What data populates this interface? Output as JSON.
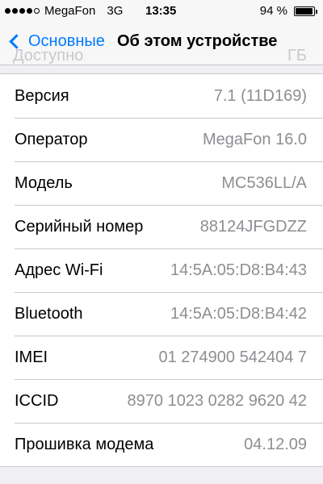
{
  "status_bar": {
    "carrier": "MegaFon",
    "network": "3G",
    "time": "13:35",
    "battery_percent": "94 %",
    "signal_dots_filled": 4,
    "signal_dots_total": 5
  },
  "navbar": {
    "back_label": "Основные",
    "title": "Об этом устройстве",
    "ghost_row_label": "Доступно",
    "ghost_row_value": "ГБ"
  },
  "rows": [
    {
      "label": "Версия",
      "value": "7.1 (11D169)"
    },
    {
      "label": "Оператор",
      "value": "MegaFon 16.0"
    },
    {
      "label": "Модель",
      "value": "MC536LL/A"
    },
    {
      "label": "Серийный номер",
      "value": "88124JFGDZZ"
    },
    {
      "label": "Адрес Wi-Fi",
      "value": "14:5A:05:D8:B4:43"
    },
    {
      "label": "Bluetooth",
      "value": "14:5A:05:D8:B4:42"
    },
    {
      "label": "IMEI",
      "value": "01 274900 542404 7"
    },
    {
      "label": "ICCID",
      "value": "8970 1023 0282 9620 42"
    },
    {
      "label": "Прошивка модема",
      "value": "04.12.09"
    }
  ],
  "colors": {
    "accent": "#007aff",
    "secondary_text": "#8e8e93",
    "background": "#efeff4"
  }
}
